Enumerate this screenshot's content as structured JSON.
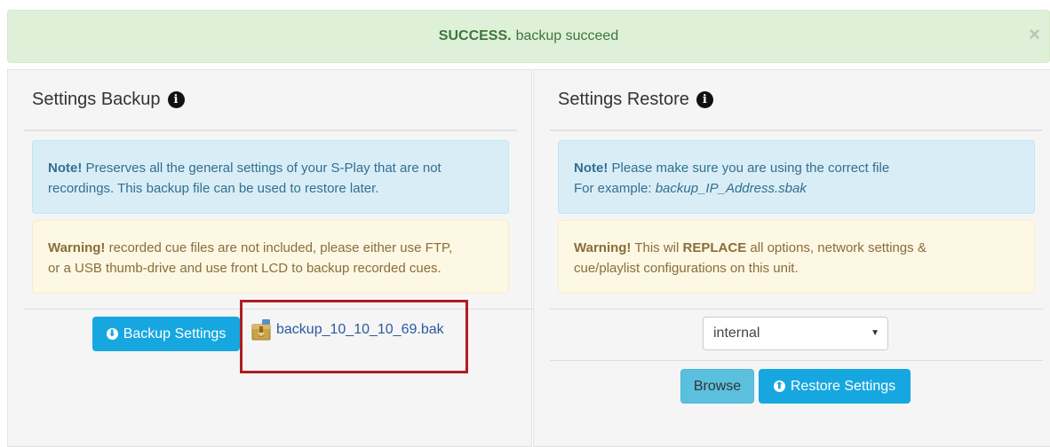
{
  "alert": {
    "strong": "SUCCESS.",
    "message": "backup succeed",
    "close": "×"
  },
  "backup": {
    "title": "Settings Backup",
    "note_label": "Note!",
    "note_text_1": "Preserves all the general settings of your S-Play that are not",
    "note_text_2": "recordings. This backup file can be used to restore later.",
    "warning_label": "Warning!",
    "warning_text_1": "recorded cue files are not included, please either use FTP,",
    "warning_text_2": "or a USB thumb-drive and use front LCD to backup recorded cues.",
    "button_label": "Backup Settings",
    "file_name": "backup_10_10_10_69.bak"
  },
  "restore": {
    "title": "Settings Restore",
    "note_label": "Note!",
    "note_text_1": "Please make sure you are using the correct file",
    "note_example_prefix": "For example:",
    "note_example_file": "backup_IP_Address.sbak",
    "warning_label": "Warning!",
    "warning_pre": "This wil",
    "warning_strong": "REPLACE",
    "warning_post": "all options, network settings &",
    "warning_text_2": "cue/playlist configurations on this unit.",
    "select_value": "internal",
    "browse_label": "Browse",
    "restore_label": "Restore Settings"
  },
  "colors": {
    "success_bg": "#dff0d8",
    "info_bg": "#d9edf7",
    "warning_bg": "#fcf8e3",
    "primary": "#17a7e0",
    "highlight": "#b01c22"
  }
}
